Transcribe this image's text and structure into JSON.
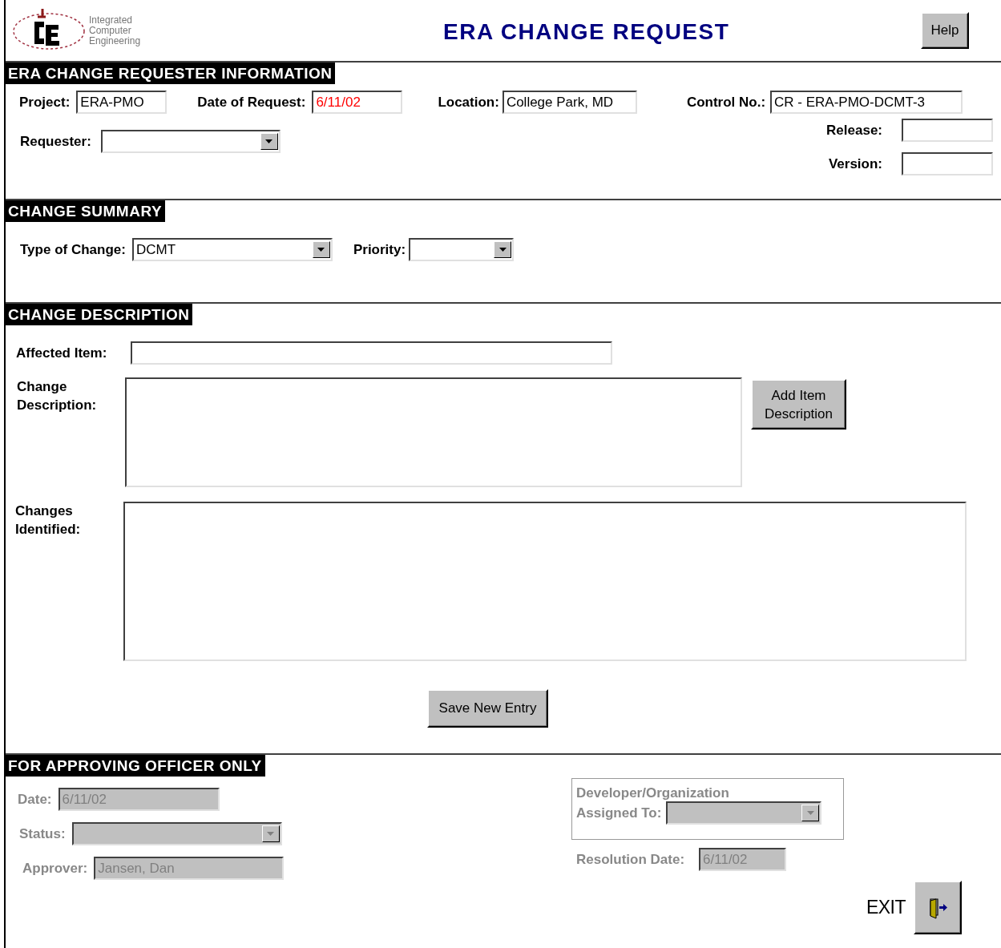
{
  "header": {
    "logo_text": [
      "Integrated",
      "Computer",
      "Engineering"
    ],
    "title": "ERA CHANGE REQUEST",
    "help_button": "Help"
  },
  "requester_info": {
    "heading": "ERA CHANGE REQUESTER INFORMATION",
    "project": {
      "label": "Project:",
      "value": "ERA-PMO"
    },
    "date_of_request": {
      "label": "Date of Request:",
      "value": "6/11/02",
      "color": "#ff0000"
    },
    "location": {
      "label": "Location:",
      "value": "College Park, MD"
    },
    "control_no": {
      "label": "Control No.:",
      "value": "CR - ERA-PMO-DCMT-3"
    },
    "requester": {
      "label": "Requester:"
    },
    "release": {
      "label": "Release:"
    },
    "version": {
      "label": "Version:"
    }
  },
  "change_summary": {
    "heading": "CHANGE SUMMARY",
    "type_of_change": {
      "label": "Type of Change:",
      "value": "DCMT"
    },
    "priority": {
      "label": "Priority:"
    }
  },
  "change_description": {
    "heading": "CHANGE DESCRIPTION",
    "affected_item": {
      "label": "Affected Item:"
    },
    "change_description": {
      "label": "Change Description:"
    },
    "add_item_button": "Add Item Description",
    "changes_identified": {
      "label": "Changes Identified:"
    },
    "save_button": "Save New Entry"
  },
  "approving_officer": {
    "heading": "FOR APPROVING OFFICER ONLY",
    "date": {
      "label": "Date:",
      "value": "6/11/02",
      "disabled": true
    },
    "status": {
      "label": "Status:",
      "disabled": true
    },
    "approver": {
      "label": "Approver:",
      "value": "Jansen, Dan",
      "disabled": true
    },
    "developer": {
      "label_lines": [
        "Developer/Organization",
        "Assigned To:"
      ],
      "disabled": true
    },
    "resolution_date": {
      "label": "Resolution Date:",
      "value": "6/11/02",
      "disabled": true
    },
    "exit_label": "EXIT"
  }
}
